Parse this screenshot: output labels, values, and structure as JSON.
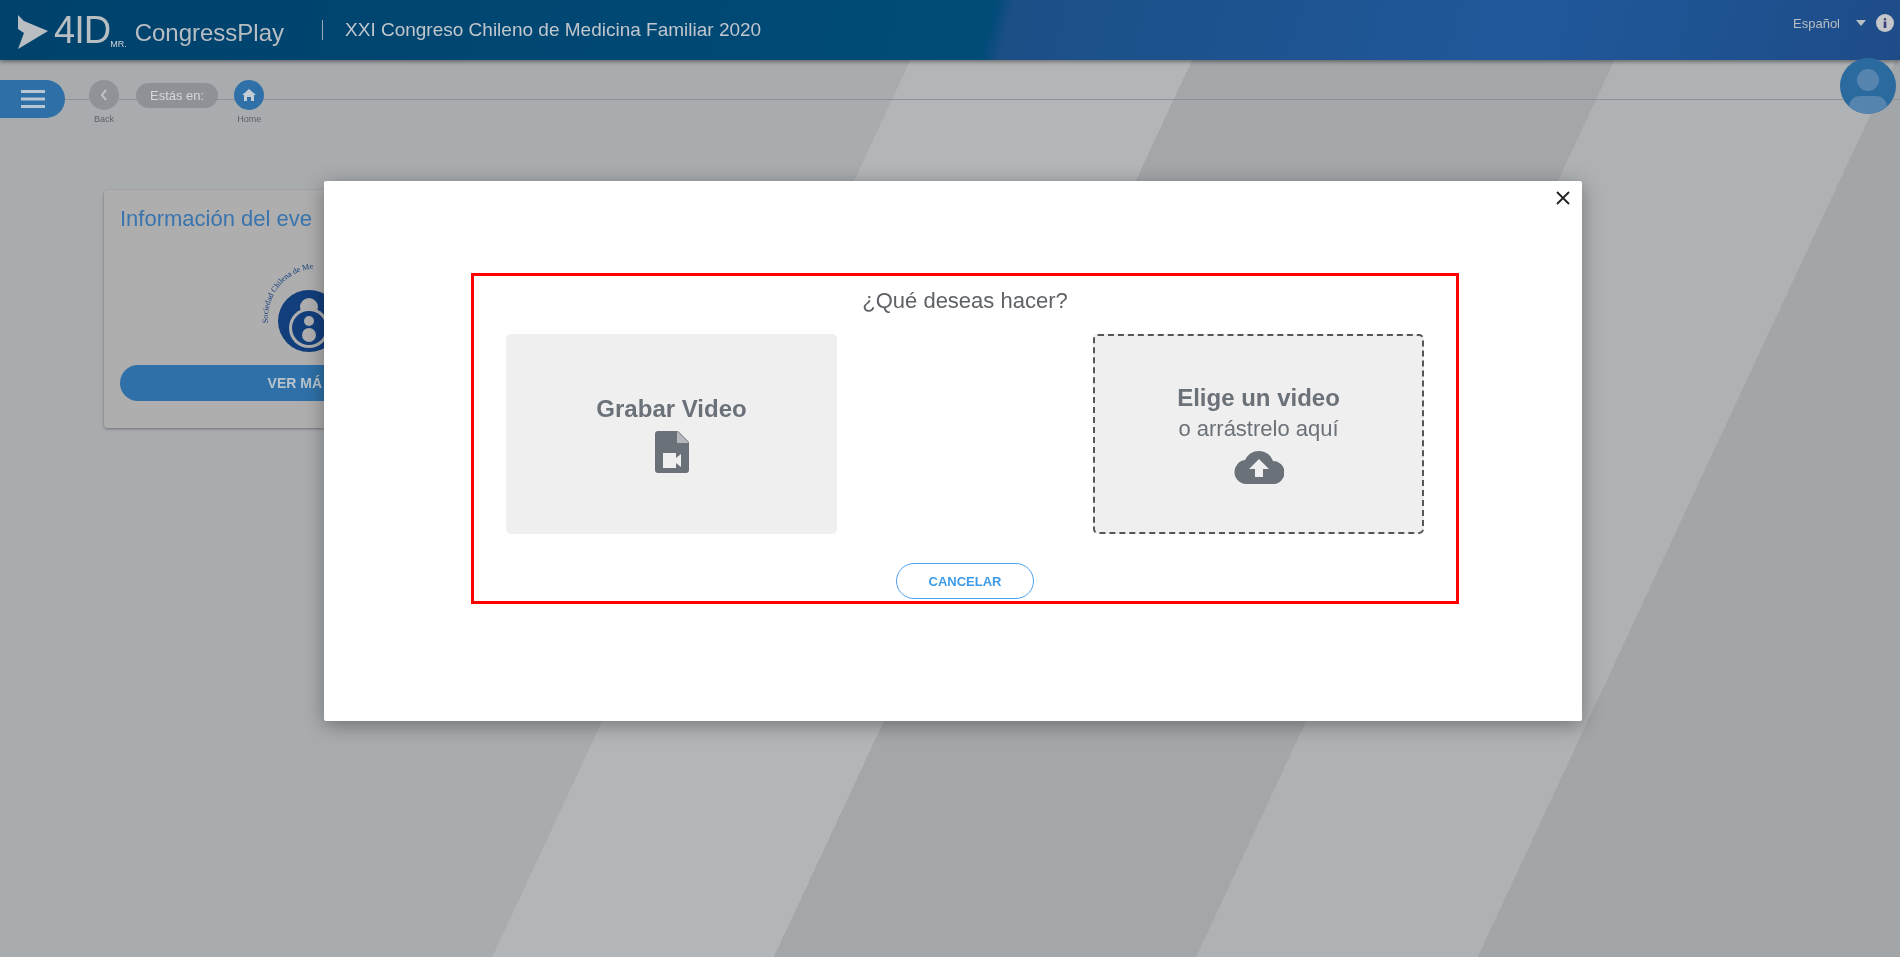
{
  "header": {
    "logo": {
      "mark": "4ID",
      "trademark": "MR.",
      "name": "CongressPlay"
    },
    "title": "XXI Congreso Chileno de Medicina Familiar 2020",
    "language": "Español"
  },
  "breadcrumb": {
    "back": "Back",
    "label": "Estás en:",
    "home": "Home"
  },
  "card": {
    "title": "Información del eve",
    "logo_text": "Sociedad Chilena de Me",
    "button": "VER MÁ"
  },
  "modal": {
    "question": "¿Qué deseas hacer?",
    "options": [
      {
        "kind": "record",
        "title": "Grabar Video"
      },
      {
        "kind": "upload",
        "title": "Elige un video",
        "subtitle": "o arrástrelo aquí"
      }
    ],
    "cancel": "CANCELAR"
  }
}
